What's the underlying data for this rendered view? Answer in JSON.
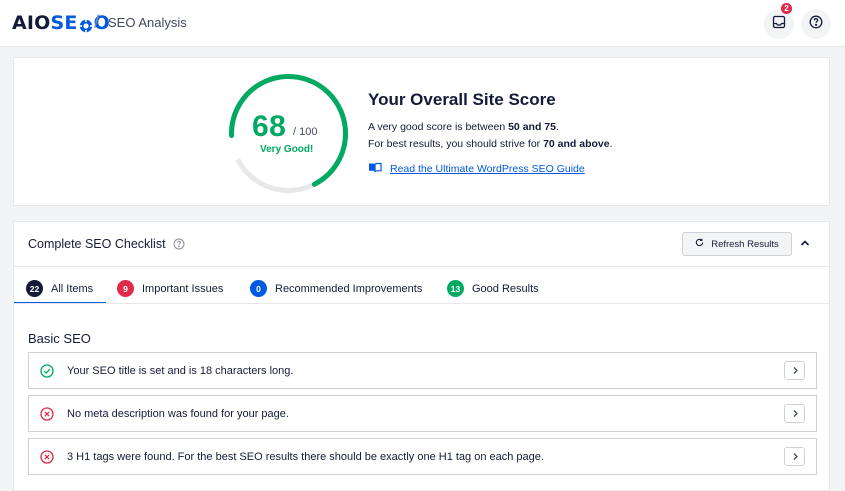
{
  "header": {
    "logo_part1": "AIO",
    "logo_part2": "SE",
    "logo_part3": "O",
    "separator": "/",
    "page_title": "SEO Analysis",
    "notification_count": "2",
    "icons": [
      "inbox-icon",
      "help-icon"
    ]
  },
  "score": {
    "value": "68",
    "max": "/ 100",
    "value_fraction": 0.68,
    "label": "Very Good!",
    "title": "Your Overall Site Score",
    "line1_prefix": "A very good score is between ",
    "line1_bold": "50 and 75",
    "line1_suffix": ".",
    "line2_prefix": "For best results, you should strive for ",
    "line2_bold": "70 and above",
    "line2_suffix": ".",
    "guide_link": "Read the Ultimate WordPress SEO Guide",
    "colors": {
      "good": "#00aa63",
      "track": "#e8e8eb"
    }
  },
  "checklist": {
    "title": "Complete SEO Checklist",
    "refresh_label": "Refresh Results",
    "tabs": [
      {
        "label": "All Items",
        "count": "22",
        "color": "#141b38"
      },
      {
        "label": "Important Issues",
        "count": "9",
        "color": "#df2a4a"
      },
      {
        "label": "Recommended Improvements",
        "count": "0",
        "color": "#005ae0"
      },
      {
        "label": "Good Results",
        "count": "13",
        "color": "#00aa63"
      }
    ],
    "section": "Basic SEO",
    "items": [
      {
        "status": "pass",
        "text": "Your SEO title is set and is 18 characters long."
      },
      {
        "status": "fail",
        "text": "No meta description was found for your page."
      },
      {
        "status": "fail",
        "text": "3 H1 tags were found. For the best SEO results there should be exactly one H1 tag on each page."
      }
    ]
  }
}
